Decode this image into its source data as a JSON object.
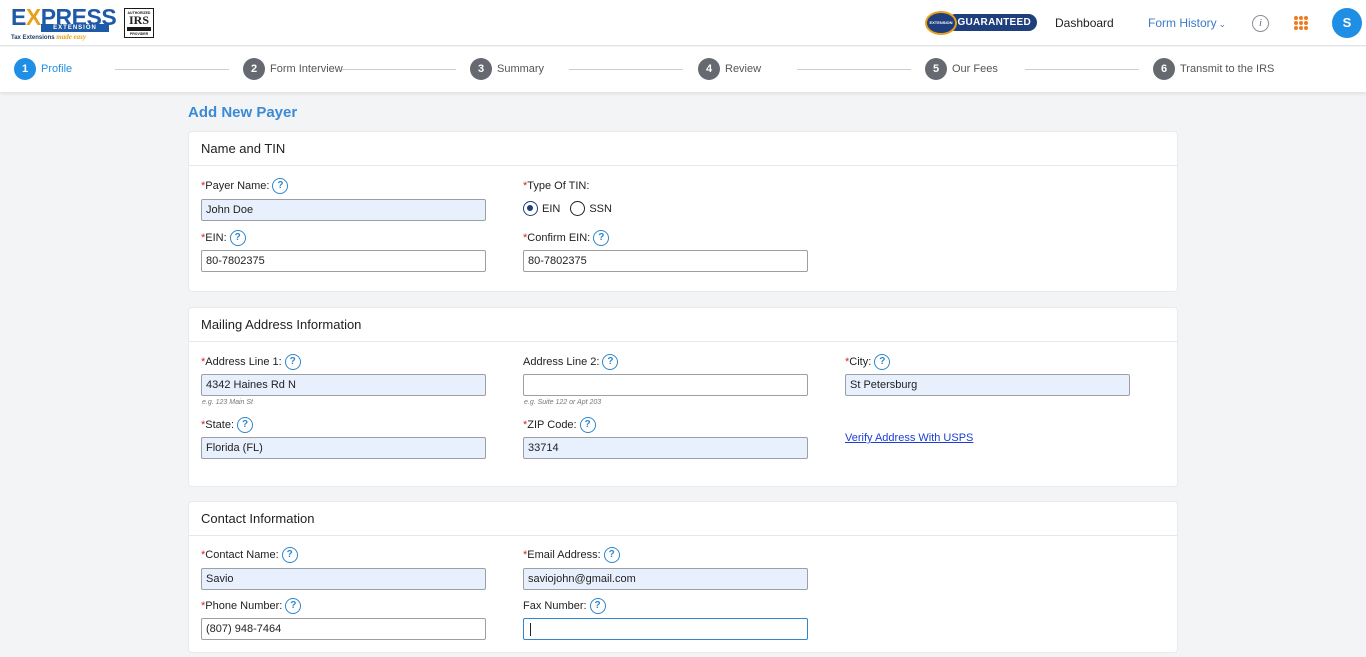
{
  "header": {
    "logo": {
      "word_pre": "E",
      "word_x": "X",
      "word_post": "PRESS",
      "sub": "EXTENSION",
      "tagline": "Tax Extensions",
      "tagline_accent": "made easy"
    },
    "irs_badge": {
      "top": "AUTHORIZED",
      "main": "IRS",
      "bottom": "PROVIDER"
    },
    "guaranteed": {
      "seal": "EXTENSION",
      "label": "GUARANTEED"
    },
    "nav": {
      "dashboard": "Dashboard",
      "form_history": "Form History"
    },
    "avatar_initial": "S"
  },
  "stepper": {
    "steps": [
      {
        "num": "1",
        "label": "Profile"
      },
      {
        "num": "2",
        "label": "Form Interview"
      },
      {
        "num": "3",
        "label": "Summary"
      },
      {
        "num": "4",
        "label": "Review"
      },
      {
        "num": "5",
        "label": "Our Fees"
      },
      {
        "num": "6",
        "label": "Transmit to the IRS"
      }
    ],
    "active": 0
  },
  "page_title": "Add New Payer",
  "name_tin": {
    "title": "Name and TIN",
    "payer_name": {
      "label": "Payer Name:",
      "value": "John Doe"
    },
    "tin_type": {
      "label": "Type Of TIN:",
      "options": [
        "EIN",
        "SSN"
      ],
      "selected": "EIN"
    },
    "ein": {
      "label": "EIN:",
      "value": "80-7802375"
    },
    "confirm_ein": {
      "label": "Confirm EIN:",
      "value": "80-7802375"
    }
  },
  "mailing": {
    "title": "Mailing Address Information",
    "address1": {
      "label": "Address Line 1:",
      "value": "4342 Haines Rd N",
      "hint": "e.g. 123 Main St"
    },
    "address2": {
      "label": "Address Line 2:",
      "value": "",
      "hint": "e.g. Suite 122 or Apt 203"
    },
    "city": {
      "label": "City:",
      "value": "St Petersburg"
    },
    "state": {
      "label": "State:",
      "value": "Florida (FL)"
    },
    "zip": {
      "label": "ZIP Code:",
      "value": "33714"
    },
    "verify_link": "Verify Address With USPS"
  },
  "contact": {
    "title": "Contact Information",
    "contact_name": {
      "label": "Contact Name:",
      "value": "Savio"
    },
    "email": {
      "label": "Email Address:",
      "value": "saviojohn@gmail.com"
    },
    "phone": {
      "label": "Phone Number:",
      "value": "(807) 948-7464"
    },
    "fax": {
      "label": "Fax Number:",
      "value": ""
    }
  },
  "colors": {
    "accent": "#1f8fe6",
    "required": "#d9232f",
    "brand": "#1f3e7e",
    "filled_bg": "#e8f0fe"
  }
}
